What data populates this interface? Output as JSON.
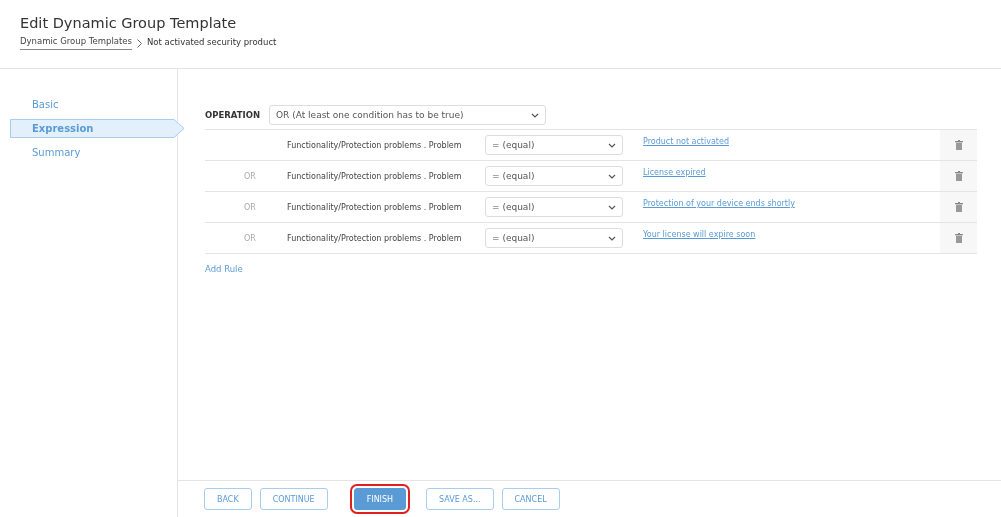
{
  "header": {
    "title": "Edit Dynamic Group Template",
    "breadcrumb": [
      {
        "label": "Dynamic Group Templates",
        "link": true
      },
      {
        "label": "Not activated security product",
        "link": false
      }
    ]
  },
  "sidebar": {
    "items": [
      {
        "label": "Basic",
        "selected": false
      },
      {
        "label": "Expression",
        "selected": true
      },
      {
        "label": "Summary",
        "selected": false
      }
    ]
  },
  "operation": {
    "label": "OPERATION",
    "value": "OR (At least one condition has to be true)"
  },
  "rules": [
    {
      "field": "Functionality/Protection problems . Problem",
      "operator": "= (equal)",
      "value": "Product not activated"
    },
    {
      "connector": "OR",
      "field": "Functionality/Protection problems . Problem",
      "operator": "= (equal)",
      "value": "License expired"
    },
    {
      "connector": "OR",
      "field": "Functionality/Protection problems . Problem",
      "operator": "= (equal)",
      "value": "Protection of your device ends shortly"
    },
    {
      "connector": "OR",
      "field": "Functionality/Protection problems . Problem",
      "operator": "= (equal)",
      "value": "Your license will expire soon"
    }
  ],
  "add_rule": "Add Rule",
  "footer": {
    "buttons": [
      {
        "label": "BACK",
        "primary": false,
        "highlighted": false
      },
      {
        "label": "CONTINUE",
        "primary": false,
        "highlighted": false
      },
      {
        "label": "FINISH",
        "primary": true,
        "highlighted": true
      },
      {
        "label": "SAVE AS...",
        "primary": false,
        "highlighted": false
      },
      {
        "label": "CANCEL",
        "primary": false,
        "highlighted": false
      }
    ]
  }
}
